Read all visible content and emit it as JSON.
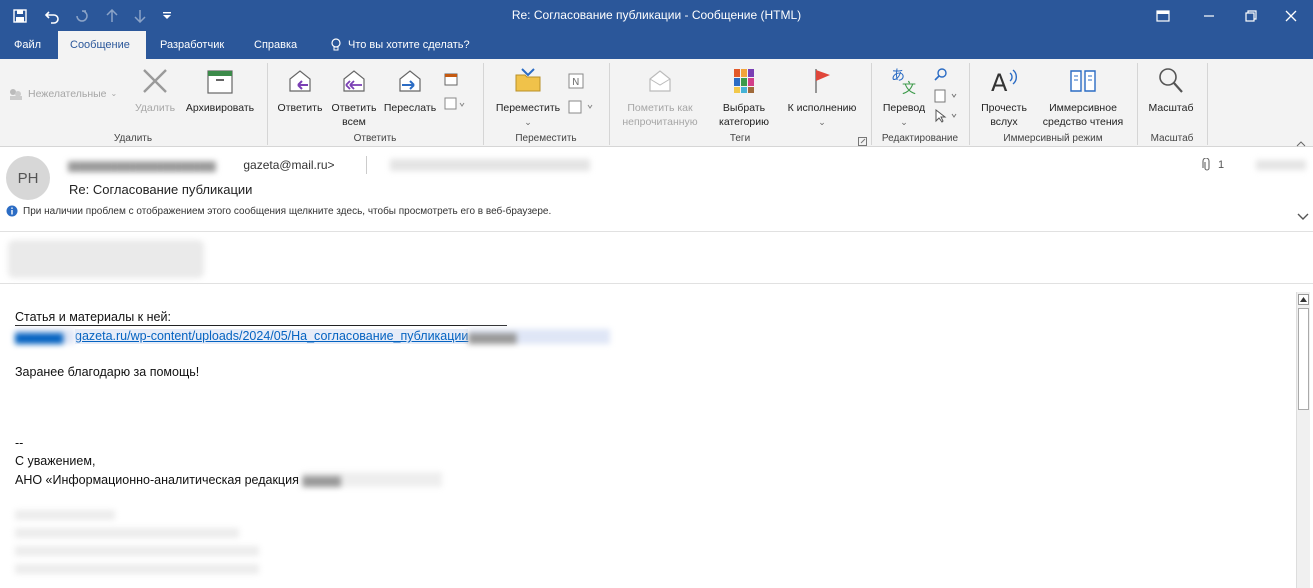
{
  "window": {
    "title": "Re: Согласование публикации  -  Сообщение (HTML)"
  },
  "tabs": [
    "Файл",
    "Сообщение",
    "Разработчик",
    "Справка"
  ],
  "tell_me": "Что вы хотите сделать?",
  "ribbon": {
    "delete_group": {
      "label": "Удалить",
      "junk": "Нежелательные",
      "delete": "Удалить",
      "archive": "Архивировать"
    },
    "respond_group": {
      "label": "Ответить",
      "reply": "Ответить",
      "reply_all_1": "Ответить",
      "reply_all_2": "всем",
      "forward": "Переслать"
    },
    "move_group": {
      "label": "Переместить",
      "move": "Переместить"
    },
    "tags_group": {
      "label": "Теги",
      "mark_unread_1": "Пометить как",
      "mark_unread_2": "непрочитанную",
      "categorize_1": "Выбрать",
      "categorize_2": "категорию",
      "follow_up": "К исполнению"
    },
    "editing_group": {
      "label": "Редактирование",
      "translate": "Перевод"
    },
    "immersive_group": {
      "label": "Иммерсивный режим",
      "read_aloud_1": "Прочесть",
      "read_aloud_2": "вслух",
      "immersive_reader_1": "Иммерсивное",
      "immersive_reader_2": "средство чтения"
    },
    "zoom_group": {
      "label": "Масштаб",
      "zoom": "Масштаб"
    }
  },
  "message": {
    "avatar_initials": "РН",
    "from": "gazeta@mail.ru>",
    "subject": "Re: Согласование публикации",
    "attachment_count": "1",
    "info_bar": "При наличии проблем с отображением этого сообщения щелкните здесь, чтобы просмотреть его в веб-браузере.",
    "body": {
      "line1": "Статья и материалы к ней:",
      "link": "gazeta.ru/wp-content/uploads/2024/05/На_согласование_публикации",
      "line2": "Заранее благодарю за помощь!",
      "sig_dash": "--",
      "sig_regards": "С уважением,",
      "sig_org": "АНО «Информационно-аналитическая редакция"
    }
  },
  "colors": {
    "title_bar": "#2b579a",
    "ribbon_bg": "#f3f3f3",
    "link": "#0563c1"
  }
}
